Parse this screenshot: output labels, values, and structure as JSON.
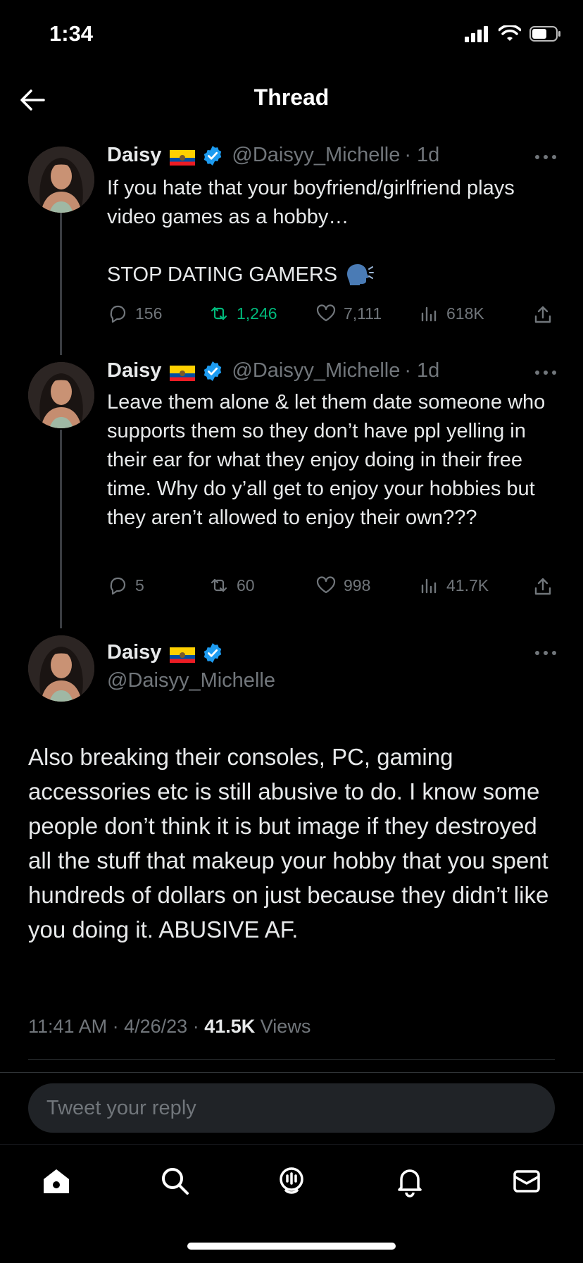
{
  "status_bar": {
    "time": "1:34"
  },
  "header": {
    "title": "Thread"
  },
  "tweets": [
    {
      "name": "Daisy",
      "handle": "@Daisyy_Michelle",
      "age": "· 1d",
      "text": "If you hate that your boyfriend/girlfriend plays video games as a hobby…\n\nSTOP DATING GAMERS",
      "emoji_icon": "speaking-head-icon",
      "replies": "156",
      "retweets": "1,246",
      "likes": "7,111",
      "views": "618K"
    },
    {
      "name": "Daisy",
      "handle": "@Daisyy_Michelle",
      "age": "· 1d",
      "text": "Leave them alone & let them date someone who supports them so they don’t have ppl yelling in their ear for what they enjoy doing in their free time. Why do y’all get to enjoy your hobbies but they aren’t allowed to enjoy their own???",
      "replies": "5",
      "retweets": "60",
      "likes": "998",
      "views": "41.7K"
    }
  ],
  "main_tweet": {
    "name": "Daisy",
    "handle": "@Daisyy_Michelle",
    "text": "Also breaking their consoles, PC, gaming accessories etc is still abusive to do. I know some people don’t think it is but image if they destroyed all the stuff that makeup your hobby that you spent hundreds of dollars on just because they didn’t like you doing it. ABUSIVE AF.",
    "time": "11:41 AM",
    "date": "4/26/23",
    "views_count": "41.5K",
    "views_label": "Views"
  },
  "reply": {
    "placeholder": "Tweet your reply"
  },
  "colors": {
    "background": "#000000",
    "text": "#e7e9ea",
    "muted": "#71767b",
    "verified": "#1d9bf0",
    "retweet_active": "#00ba7c"
  }
}
